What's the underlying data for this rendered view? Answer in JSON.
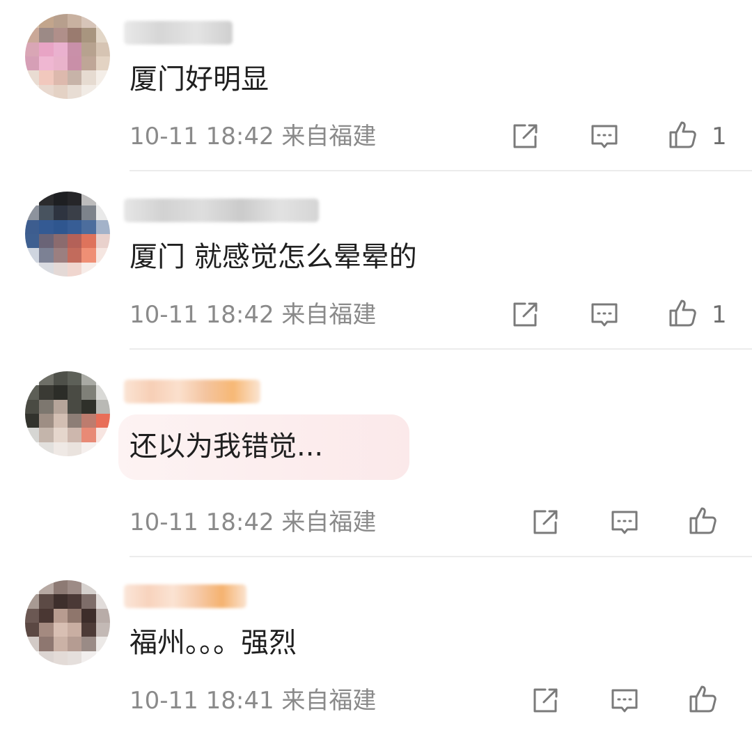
{
  "comments": [
    {
      "text": "厦门好明显",
      "meta": "10-11 18:42 来自福建",
      "likes": "1",
      "highlighted": false
    },
    {
      "text": "厦门 就感觉怎么晕晕的",
      "meta": "10-11 18:42 来自福建",
      "likes": "1",
      "highlighted": false
    },
    {
      "text": "还以为我错觉...",
      "meta": "10-11 18:42 来自福建",
      "likes": "",
      "highlighted": true
    },
    {
      "text": "福州。。。强烈",
      "meta": "10-11 18:41 来自福建",
      "likes": "",
      "highlighted": false
    }
  ],
  "icons": {
    "share": "share-icon",
    "reply": "comment-icon",
    "like": "thumbs-up-icon"
  },
  "colors": {
    "text": "#1f1f1f",
    "meta": "#8a8a8a",
    "icon": "#7a7a7a",
    "highlight_bubble": "#fbe9ea"
  }
}
